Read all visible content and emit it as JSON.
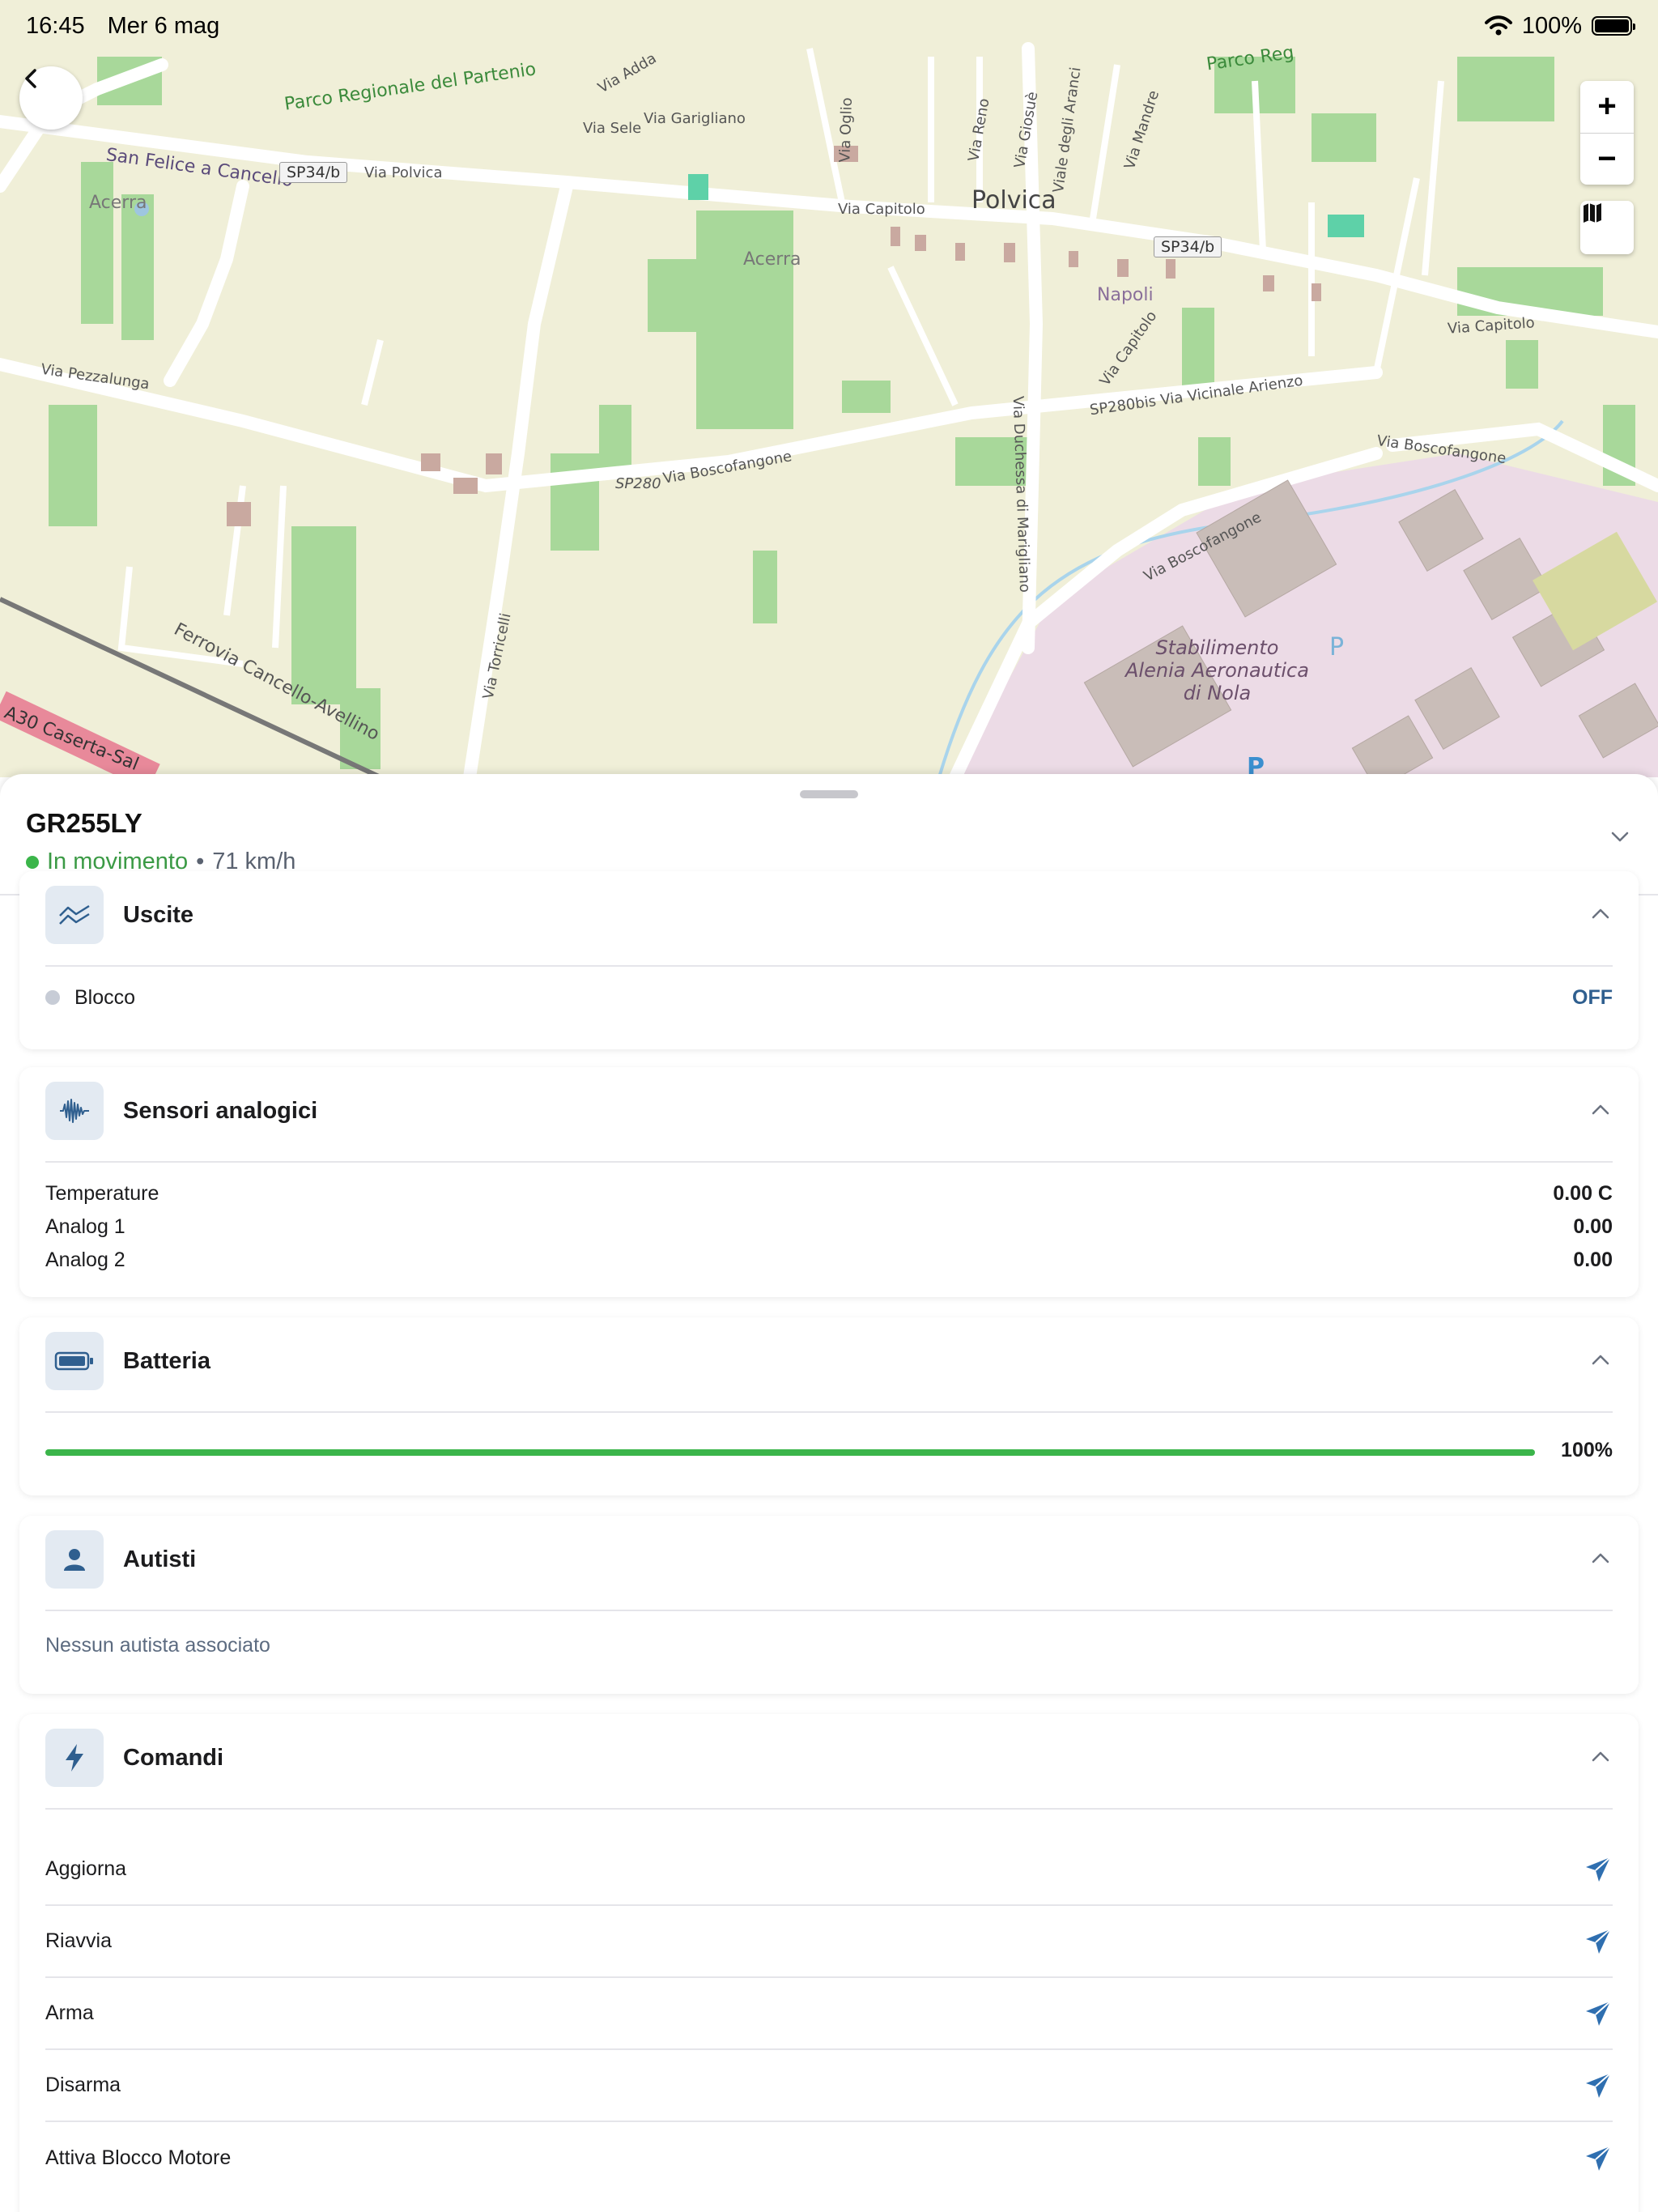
{
  "status_bar": {
    "time": "16:45",
    "date": "Mer 6 mag",
    "battery": "100%"
  },
  "map": {
    "labels": {
      "parco1": "Parco Regionale del Partenio",
      "parco2": "Parco Reg",
      "san_felice": "San Felice a Cancello",
      "sp34b_1": "SP34/b",
      "via_polvica": "Via Polvica",
      "via_capitolo_1": "Via Capitolo",
      "polvica": "Polvica",
      "sp34b_2": "SP34/b",
      "acerra_1": "Acerra",
      "acerra_2": "Acerra",
      "napoli": "Napoli",
      "via_pezzalunga": "Via Pezzalunga",
      "via_capitolo_2": "Via Capitolo",
      "sp280": "SP280",
      "via_boscofangone_1": "Via Boscofangone",
      "via_vicinale": "SP280bis Via Vicinale Arienzo",
      "via_boscofangone_2": "Via Boscofangone",
      "via_boscofangone_3": "Via Boscofangone",
      "via_capitolo_3": "Via Capitolo",
      "ferrovia": "Ferrovia Cancello-Avellino",
      "a30": "A30 Caserta-Sal",
      "stabilimento": "Stabilimento\nAlenia Aeronautica\ndi Nola",
      "via_adda": "Via Adda",
      "via_sele": "Via Sele",
      "via_garigliano": "Via Garigliano",
      "via_reno": "Via Reno",
      "via_giosue": "Via Giosuè",
      "via_aranci": "Viale degli Aranci",
      "via_mandre": "Via Mandre",
      "via_oglio": "Via Oglio",
      "via_torricelli": "Via Torricelli",
      "via_duchessa": "Via Duchessa di Marigliano",
      "parking_1": "P",
      "parking_2": "P"
    },
    "zoom_in": "+",
    "zoom_out": "−"
  },
  "vehicle": {
    "plate": "GR255LY",
    "status": "In movimento",
    "speed": "71 km/h"
  },
  "colors": {
    "accent": "#2f6fb0",
    "moving": "#3bb54a",
    "muted": "#5c6b80"
  },
  "cards": {
    "uscite": {
      "title": "Uscite",
      "icon": "wave-icon",
      "rows": [
        {
          "label": "Blocco",
          "value": "OFF"
        }
      ]
    },
    "sensori": {
      "title": "Sensori analogici",
      "icon": "waveform-icon",
      "rows": [
        {
          "label": "Temperature",
          "value": "0.00 C"
        },
        {
          "label": "Analog 1",
          "value": "0.00"
        },
        {
          "label": "Analog 2",
          "value": "0.00"
        }
      ]
    },
    "batteria": {
      "title": "Batteria",
      "icon": "battery-icon",
      "percent": 100,
      "percent_label": "100%"
    },
    "autisti": {
      "title": "Autisti",
      "icon": "person-icon",
      "empty": "Nessun autista associato"
    },
    "comandi": {
      "title": "Comandi",
      "icon": "bolt-icon",
      "items": [
        "Aggiorna",
        "Riavvia",
        "Arma",
        "Disarma",
        "Attiva Blocco Motore"
      ]
    }
  }
}
